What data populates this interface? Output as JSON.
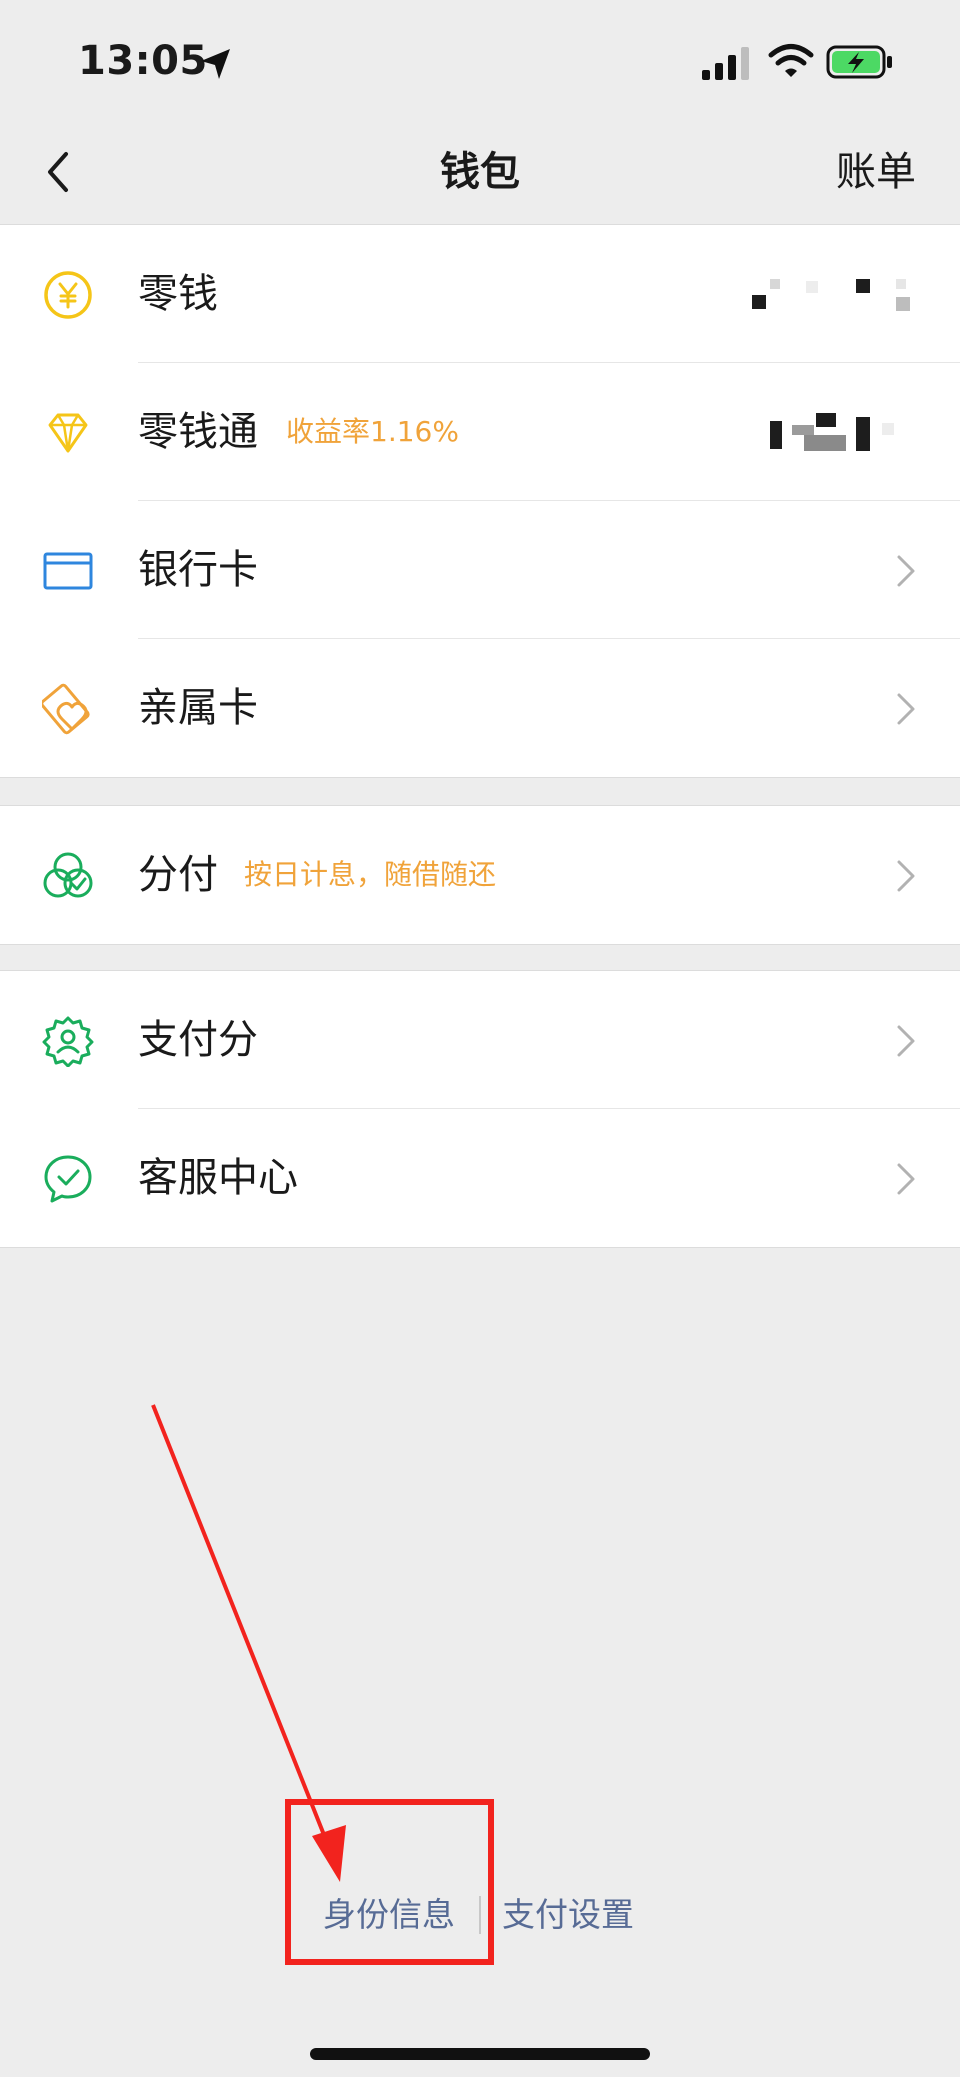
{
  "status_bar": {
    "time": "13:05",
    "icons": [
      "location-arrow-icon",
      "signal-icon",
      "wifi-icon",
      "battery-charging-icon"
    ],
    "battery_color": "#4cd964"
  },
  "nav": {
    "title": "钱包",
    "right_action": "账单",
    "back_icon": "chevron-left-icon"
  },
  "groups": [
    {
      "items": [
        {
          "label": "零钱",
          "icon": "yuan-coin-icon",
          "value": "(masked)",
          "accent": "#f5c518"
        },
        {
          "label": "零钱通",
          "tag": "收益率1.16%",
          "icon": "diamond-icon",
          "value": "(masked)",
          "accent": "#f5c518"
        },
        {
          "label": "银行卡",
          "icon": "bank-card-icon",
          "accent": "#2e86de"
        },
        {
          "label": "亲属卡",
          "icon": "family-card-icon",
          "accent": "#f0a33a"
        }
      ]
    },
    {
      "items": [
        {
          "label": "分付",
          "tag": "按日计息，随借随还",
          "icon": "fenfu-icon",
          "accent": "#1aad5c"
        }
      ]
    },
    {
      "items": [
        {
          "label": "支付分",
          "icon": "pay-score-badge-icon",
          "accent": "#1aad5c"
        },
        {
          "label": "客服中心",
          "icon": "customer-service-icon",
          "accent": "#1aad5c"
        }
      ]
    }
  ],
  "footer": {
    "link_identity": "身份信息",
    "link_settings": "支付设置",
    "link_color": "#576b95"
  },
  "annotation": {
    "color": "#f2231e"
  }
}
